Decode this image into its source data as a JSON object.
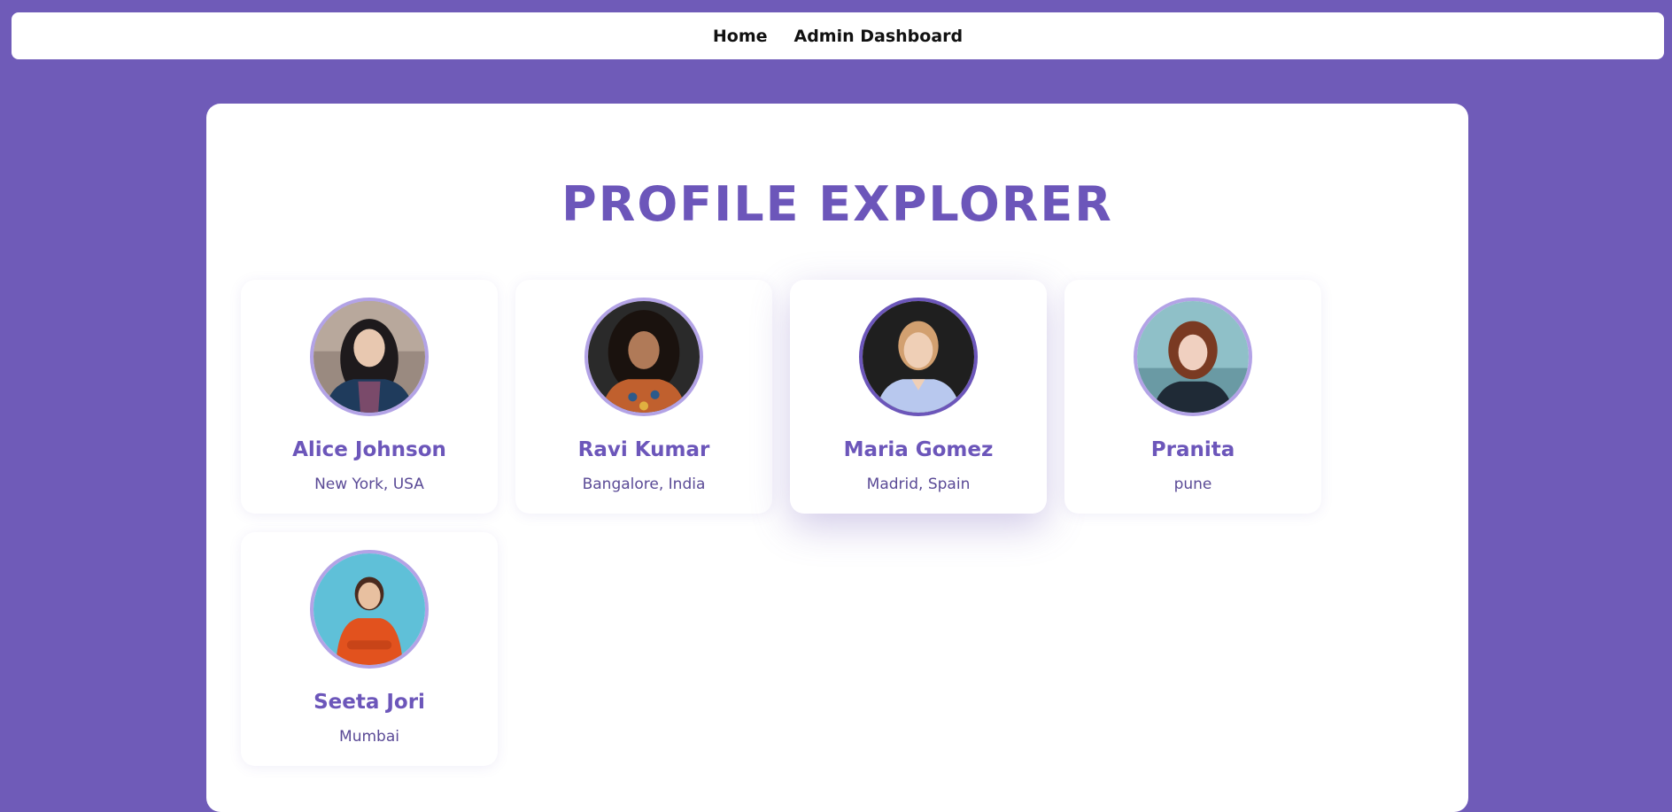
{
  "nav": {
    "home": "Home",
    "admin": "Admin Dashboard"
  },
  "page": {
    "title": "PROFILE EXPLORER"
  },
  "profiles": [
    {
      "name": "Alice Johnson",
      "location": "New York, USA"
    },
    {
      "name": "Ravi Kumar",
      "location": "Bangalore, India"
    },
    {
      "name": "Maria Gomez",
      "location": "Madrid, Spain"
    },
    {
      "name": "Pranita",
      "location": "pune"
    },
    {
      "name": "Seeta Jori",
      "location": "Mumbai"
    }
  ],
  "colors": {
    "background": "#6f5bb8",
    "accent": "#6c56ba",
    "avatar_border": "#b3a3e6"
  }
}
